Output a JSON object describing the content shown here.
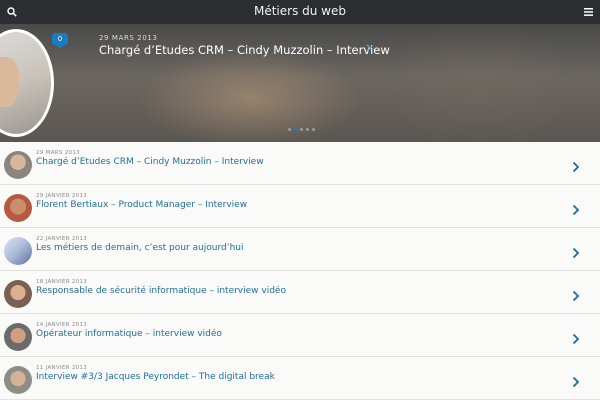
{
  "header": {
    "title": "Métiers du web",
    "search_icon": "search-icon",
    "menu_icon": "hamburger-menu-icon"
  },
  "hero": {
    "comment_count": "0",
    "date": "29 MARS 2013",
    "title": "Chargé d’Etudes CRM – Cindy Muzzolin – Interview",
    "dots": 5,
    "active_dot": 1
  },
  "articles": [
    {
      "date": "29 MARS 2013",
      "title": "Chargé d’Etudes CRM – Cindy Muzzolin – Interview"
    },
    {
      "date": "29 JANVIER 2013",
      "title": "Florent Bertiaux – Product Manager – Interview"
    },
    {
      "date": "22 JANVIER 2013",
      "title": "Les métiers de demain, c’est pour aujourd’hui"
    },
    {
      "date": "18 JANVIER 2013",
      "title": "Responsable de sécurité informatique – interview vidéo"
    },
    {
      "date": "14 JANVIER 2013",
      "title": "Opérateur informatique – interview vidéo"
    },
    {
      "date": "11 JANVIER 2013",
      "title": "Interview #3/3 Jacques Peyrondet – The digital break"
    }
  ],
  "colors": {
    "topbar": "#2c2d31",
    "accent": "#1a7bbf",
    "link": "#1f6f9f"
  }
}
